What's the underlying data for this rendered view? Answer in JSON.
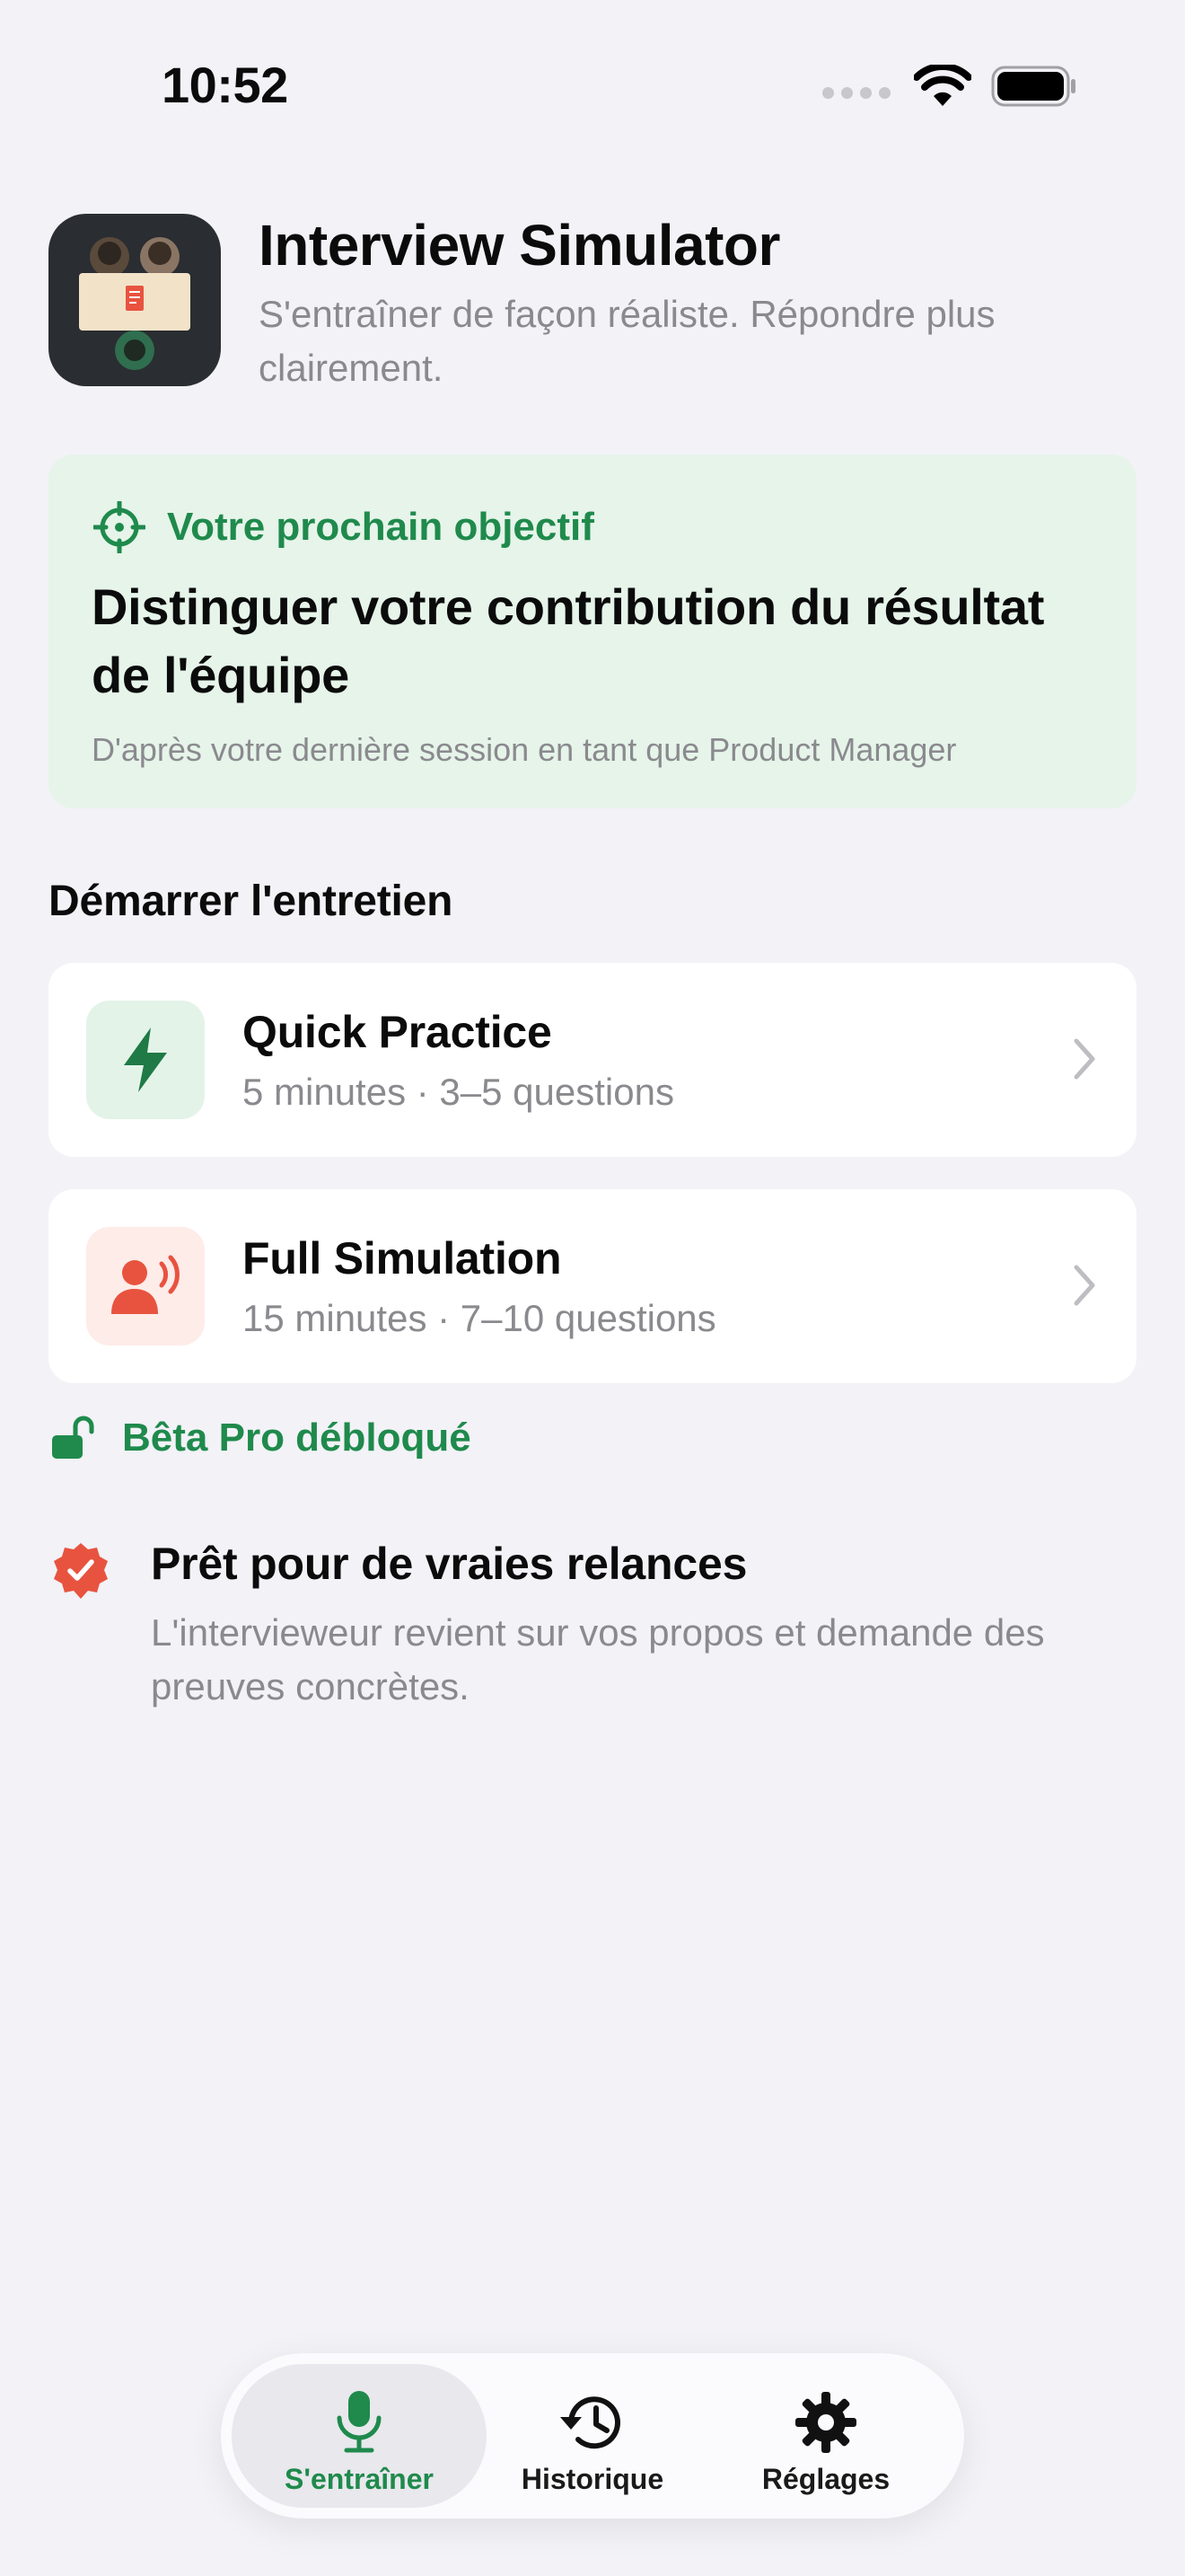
{
  "status_bar": {
    "time": "10:52"
  },
  "header": {
    "app_icon": "interview-table-icon",
    "title": "Interview Simulator",
    "subtitle": "S'entraîner de façon réaliste. Répondre plus clairement."
  },
  "goal": {
    "icon": "target-icon",
    "label": "Votre prochain objectif",
    "text": "Distinguer votre contribution du résultat de l'équipe",
    "note": "D'après votre dernière session en tant que Product Manager"
  },
  "start_section": {
    "title": "Démarrer l'entretien",
    "options": [
      {
        "title": "Quick Practice",
        "subtitle": "5 minutes · 3–5 questions",
        "icon": "bolt-icon"
      },
      {
        "title": "Full Simulation",
        "subtitle": "15 minutes · 7–10 questions",
        "icon": "speaking-person-icon"
      }
    ]
  },
  "beta": {
    "icon": "unlock-icon",
    "label": "Bêta Pro débloqué"
  },
  "ready": {
    "icon": "checkmark-seal-icon",
    "title": "Prêt pour de vraies relances",
    "subtitle": "L'intervieweur revient sur vos propos et demande des preuves concrètes."
  },
  "tabbar": {
    "tabs": [
      {
        "label": "S'entraîner",
        "icon": "mic-icon",
        "active": true
      },
      {
        "label": "Historique",
        "icon": "history-icon",
        "active": false
      },
      {
        "label": "Réglages",
        "icon": "gear-icon",
        "active": false
      }
    ]
  },
  "colors": {
    "accent_green": "#1F8A4C",
    "goal_bg": "#E6F4EA",
    "quick_icon_bg": "#E3F3E8",
    "full_icon_bg": "#FDECE8",
    "coral": "#E8533F",
    "background": "#F2F2F7"
  }
}
